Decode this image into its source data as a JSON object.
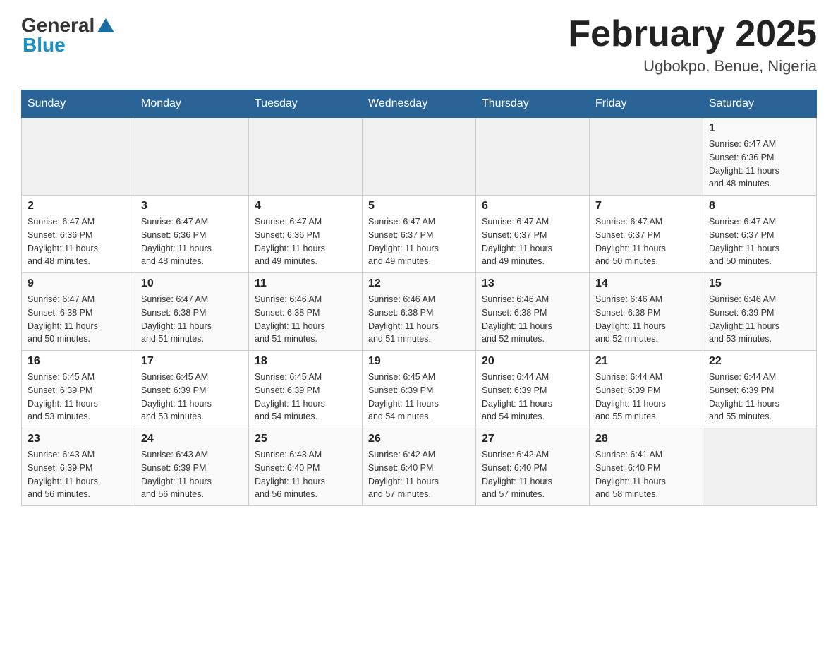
{
  "header": {
    "logo_general": "General",
    "logo_blue": "Blue",
    "title": "February 2025",
    "subtitle": "Ugbokpo, Benue, Nigeria"
  },
  "weekdays": [
    "Sunday",
    "Monday",
    "Tuesday",
    "Wednesday",
    "Thursday",
    "Friday",
    "Saturday"
  ],
  "weeks": [
    [
      {
        "day": "",
        "info": ""
      },
      {
        "day": "",
        "info": ""
      },
      {
        "day": "",
        "info": ""
      },
      {
        "day": "",
        "info": ""
      },
      {
        "day": "",
        "info": ""
      },
      {
        "day": "",
        "info": ""
      },
      {
        "day": "1",
        "info": "Sunrise: 6:47 AM\nSunset: 6:36 PM\nDaylight: 11 hours\nand 48 minutes."
      }
    ],
    [
      {
        "day": "2",
        "info": "Sunrise: 6:47 AM\nSunset: 6:36 PM\nDaylight: 11 hours\nand 48 minutes."
      },
      {
        "day": "3",
        "info": "Sunrise: 6:47 AM\nSunset: 6:36 PM\nDaylight: 11 hours\nand 48 minutes."
      },
      {
        "day": "4",
        "info": "Sunrise: 6:47 AM\nSunset: 6:36 PM\nDaylight: 11 hours\nand 49 minutes."
      },
      {
        "day": "5",
        "info": "Sunrise: 6:47 AM\nSunset: 6:37 PM\nDaylight: 11 hours\nand 49 minutes."
      },
      {
        "day": "6",
        "info": "Sunrise: 6:47 AM\nSunset: 6:37 PM\nDaylight: 11 hours\nand 49 minutes."
      },
      {
        "day": "7",
        "info": "Sunrise: 6:47 AM\nSunset: 6:37 PM\nDaylight: 11 hours\nand 50 minutes."
      },
      {
        "day": "8",
        "info": "Sunrise: 6:47 AM\nSunset: 6:37 PM\nDaylight: 11 hours\nand 50 minutes."
      }
    ],
    [
      {
        "day": "9",
        "info": "Sunrise: 6:47 AM\nSunset: 6:38 PM\nDaylight: 11 hours\nand 50 minutes."
      },
      {
        "day": "10",
        "info": "Sunrise: 6:47 AM\nSunset: 6:38 PM\nDaylight: 11 hours\nand 51 minutes."
      },
      {
        "day": "11",
        "info": "Sunrise: 6:46 AM\nSunset: 6:38 PM\nDaylight: 11 hours\nand 51 minutes."
      },
      {
        "day": "12",
        "info": "Sunrise: 6:46 AM\nSunset: 6:38 PM\nDaylight: 11 hours\nand 51 minutes."
      },
      {
        "day": "13",
        "info": "Sunrise: 6:46 AM\nSunset: 6:38 PM\nDaylight: 11 hours\nand 52 minutes."
      },
      {
        "day": "14",
        "info": "Sunrise: 6:46 AM\nSunset: 6:38 PM\nDaylight: 11 hours\nand 52 minutes."
      },
      {
        "day": "15",
        "info": "Sunrise: 6:46 AM\nSunset: 6:39 PM\nDaylight: 11 hours\nand 53 minutes."
      }
    ],
    [
      {
        "day": "16",
        "info": "Sunrise: 6:45 AM\nSunset: 6:39 PM\nDaylight: 11 hours\nand 53 minutes."
      },
      {
        "day": "17",
        "info": "Sunrise: 6:45 AM\nSunset: 6:39 PM\nDaylight: 11 hours\nand 53 minutes."
      },
      {
        "day": "18",
        "info": "Sunrise: 6:45 AM\nSunset: 6:39 PM\nDaylight: 11 hours\nand 54 minutes."
      },
      {
        "day": "19",
        "info": "Sunrise: 6:45 AM\nSunset: 6:39 PM\nDaylight: 11 hours\nand 54 minutes."
      },
      {
        "day": "20",
        "info": "Sunrise: 6:44 AM\nSunset: 6:39 PM\nDaylight: 11 hours\nand 54 minutes."
      },
      {
        "day": "21",
        "info": "Sunrise: 6:44 AM\nSunset: 6:39 PM\nDaylight: 11 hours\nand 55 minutes."
      },
      {
        "day": "22",
        "info": "Sunrise: 6:44 AM\nSunset: 6:39 PM\nDaylight: 11 hours\nand 55 minutes."
      }
    ],
    [
      {
        "day": "23",
        "info": "Sunrise: 6:43 AM\nSunset: 6:39 PM\nDaylight: 11 hours\nand 56 minutes."
      },
      {
        "day": "24",
        "info": "Sunrise: 6:43 AM\nSunset: 6:39 PM\nDaylight: 11 hours\nand 56 minutes."
      },
      {
        "day": "25",
        "info": "Sunrise: 6:43 AM\nSunset: 6:40 PM\nDaylight: 11 hours\nand 56 minutes."
      },
      {
        "day": "26",
        "info": "Sunrise: 6:42 AM\nSunset: 6:40 PM\nDaylight: 11 hours\nand 57 minutes."
      },
      {
        "day": "27",
        "info": "Sunrise: 6:42 AM\nSunset: 6:40 PM\nDaylight: 11 hours\nand 57 minutes."
      },
      {
        "day": "28",
        "info": "Sunrise: 6:41 AM\nSunset: 6:40 PM\nDaylight: 11 hours\nand 58 minutes."
      },
      {
        "day": "",
        "info": ""
      }
    ]
  ]
}
